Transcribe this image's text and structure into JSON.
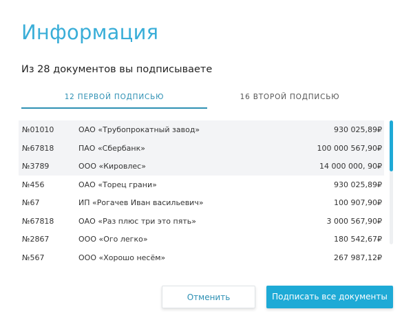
{
  "dialog": {
    "title": "Информация",
    "subtitle": "Из 28 документов вы подписываете"
  },
  "tabs": [
    {
      "label": "12 ПЕРВОЙ ПОДПИСЬЮ",
      "active": true
    },
    {
      "label": "16 ВТОРОЙ ПОДПИСЬЮ",
      "active": false
    }
  ],
  "documents": [
    {
      "number": "№01010",
      "name": "ОАО «Трубопрокатный завод»",
      "amount": "930 025,89₽"
    },
    {
      "number": "№67818",
      "name": "ПАО «Сбербанк»",
      "amount": "100 000 567,90₽"
    },
    {
      "number": "№3789",
      "name": "ООО «Кировлес»",
      "amount": "14 000 000, 90₽"
    },
    {
      "number": "№456",
      "name": "ОАО «Торец грани»",
      "amount": "930 025,89₽"
    },
    {
      "number": "№67",
      "name": "ИП «Рогачев Иван васильевич»",
      "amount": "100 907,90₽"
    },
    {
      "number": "№67818",
      "name": "ОАО «Раз плюс три это пять»",
      "amount": "3 000 567,90₽"
    },
    {
      "number": "№2867",
      "name": "ООО «Ого легко»",
      "amount": "180 542,67₽"
    },
    {
      "number": "№567",
      "name": "ООО «Хорошо несём»",
      "amount": "267 987,12₽"
    }
  ],
  "buttons": {
    "cancel": "Отменить",
    "sign_all": "Подписать все документы"
  },
  "colors": {
    "accent": "#3aaed8",
    "primary_button": "#1eaad6",
    "tab_active": "#2c8fb3",
    "row_shade": "#f3f4f6"
  }
}
